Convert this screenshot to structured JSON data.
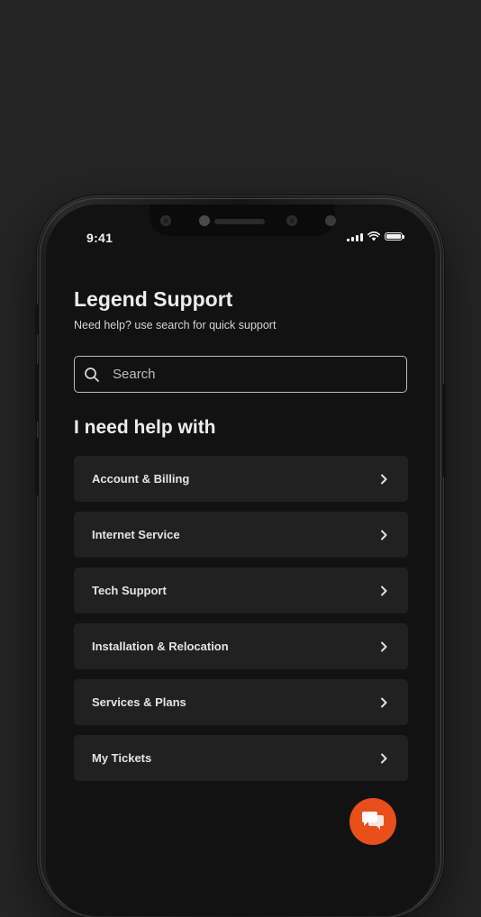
{
  "status_bar": {
    "time": "9:41",
    "icons": [
      "signal-icon",
      "wifi-icon",
      "battery-icon"
    ]
  },
  "header": {
    "title": "Legend Support",
    "subtitle": "Need help? use search for quick support"
  },
  "search": {
    "placeholder": "Search",
    "value": "",
    "icon": "search-icon"
  },
  "section": {
    "title": "I need help with"
  },
  "menu": {
    "items": [
      {
        "label": "Account & Billing",
        "icon": "chevron-right-icon"
      },
      {
        "label": "Internet Service",
        "icon": "chevron-right-icon"
      },
      {
        "label": "Tech Support",
        "icon": "chevron-right-icon"
      },
      {
        "label": "Installation & Relocation",
        "icon": "chevron-right-icon"
      },
      {
        "label": "Services & Plans",
        "icon": "chevron-right-icon"
      },
      {
        "label": "My Tickets",
        "icon": "chevron-right-icon"
      }
    ]
  },
  "chat_button": {
    "icon": "chat-bubbles-icon",
    "color": "#e84f1b"
  },
  "colors": {
    "background": "#262525",
    "screen": "#121212",
    "card": "#222121",
    "accent": "#e84f1b",
    "text": "#ededed"
  }
}
